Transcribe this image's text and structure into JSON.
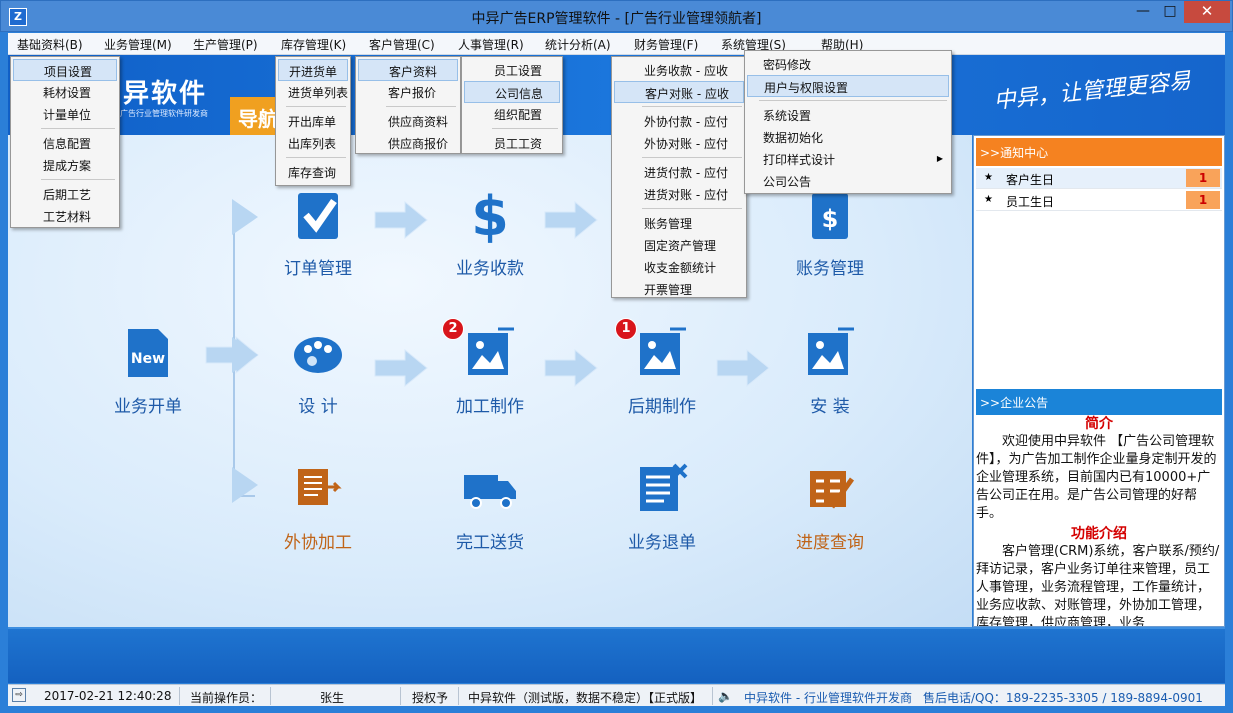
{
  "window": {
    "title": "中异广告ERP管理软件 - [广告行业管理领航者]",
    "app_icon": "Z",
    "min": "—",
    "max": "□",
    "close": "✕"
  },
  "menubar": [
    "基础资料(B)",
    "业务管理(M)",
    "生产管理(P)",
    "库存管理(K)",
    "客户管理(C)",
    "人事管理(R)",
    "统计分析(A)",
    "财务管理(F)",
    "系统管理(S)",
    "帮助(H)"
  ],
  "banner": {
    "brand": "异软件",
    "brand_sub": "广告行业管理软件研发商",
    "nav": "导航",
    "slogan": "中异，让管理更容易"
  },
  "dropdowns": {
    "basic": [
      "项目设置",
      "耗材设置",
      "计量单位",
      "信息配置",
      "提成方案",
      "后期工艺",
      "工艺材料"
    ],
    "inventory": [
      "开进货单",
      "进货单列表",
      "开出库单",
      "出库列表",
      "库存查询"
    ],
    "customer": [
      "客户资料",
      "客户报价",
      "供应商资料",
      "供应商报价"
    ],
    "hr": [
      "员工设置",
      "公司信息",
      "组织配置",
      "员工工资"
    ],
    "finance": [
      "业务收款 - 应收",
      "客户对账 - 应收",
      "外协付款 - 应付",
      "外协对账 - 应付",
      "进货付款 - 应付",
      "进货对账 - 应付",
      "账务管理",
      "固定资产管理",
      "收支金额统计",
      "开票管理"
    ],
    "system": [
      "密码修改",
      "用户与权限设置",
      "系统设置",
      "数据初始化",
      "打印样式设计",
      "公司公告"
    ]
  },
  "flow": {
    "order": "订单管理",
    "collect": "业务收款",
    "account": "账务管理",
    "new": "业务开单",
    "new_icon_text": "New",
    "design": "设 计",
    "process": "加工制作",
    "post": "后期制作",
    "install": "安 装",
    "outsource": "外协加工",
    "deliver": "完工送货",
    "return": "业务退单",
    "progress": "进度查询",
    "badge_process": "2",
    "badge_post": "1"
  },
  "notice": {
    "title": ">>通知中心",
    "rows": [
      {
        "label": "客户生日",
        "count": "1"
      },
      {
        "label": "员工生日",
        "count": "1"
      }
    ]
  },
  "announcement": {
    "title": ">>企业公告",
    "intro_title": "简介",
    "intro": "欢迎使用中异软件 【广告公司管理软件】，为广告加工制作企业量身定制开发的企业管理系统，目前国内已有10000+广告公司正在用。是广告公司管理的好帮手。",
    "features_title": "功能介绍",
    "features": "客户管理(CRM)系统，客户联系/预约/拜访记录，客户业务订单往来管理，员工人事管理，业务流程管理，工作量统计，业务应收款、对账管理，外协加工管理，库存管理，供应商管理，业务"
  },
  "status": {
    "datetime": "2017-02-21 12:40:28",
    "operator_label": "当前操作员：",
    "operator": "张生",
    "license": "授权予",
    "edition": "中异软件（测试版，数据不稳定）【正式版】",
    "company": "中异软件 - 行业管理软件开发商",
    "phone": "售后电话/QQ：189-2235-3305 / 189-8894-0901"
  }
}
